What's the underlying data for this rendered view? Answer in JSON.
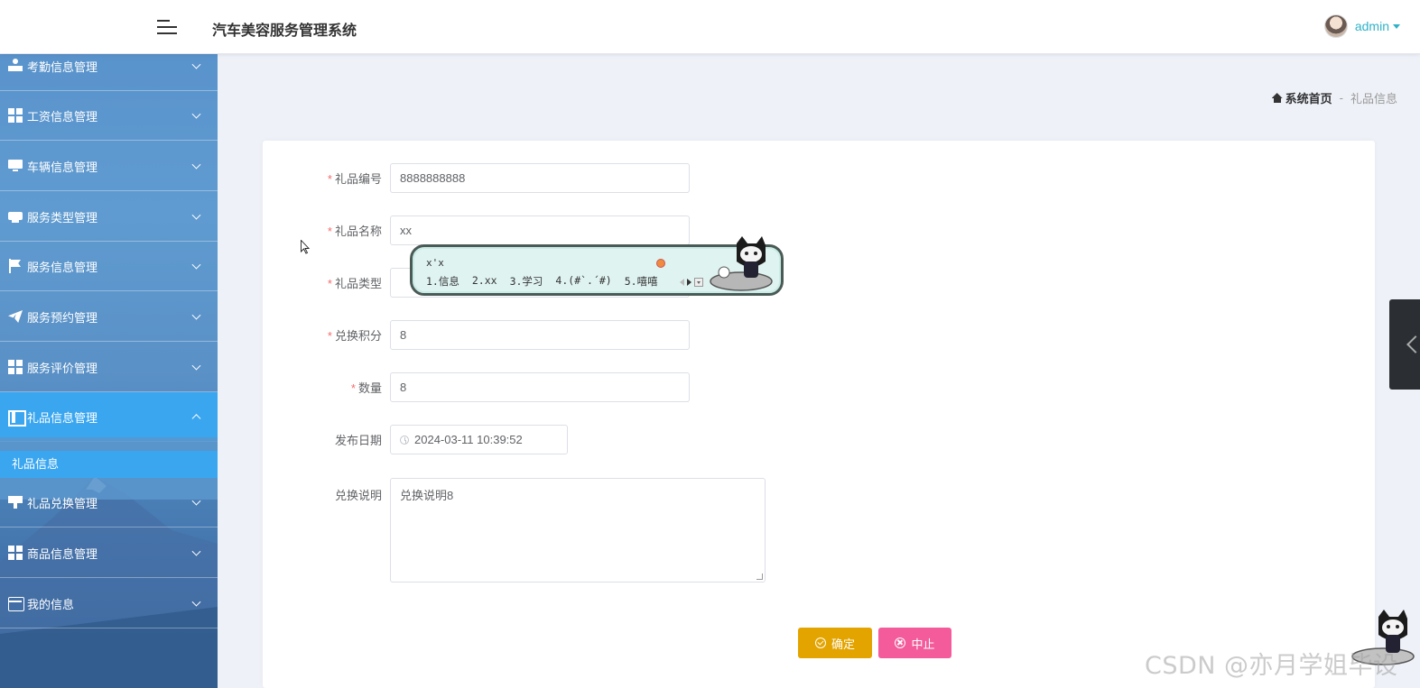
{
  "header": {
    "app_title": "汽车美容服务管理系统",
    "username": "admin"
  },
  "sidebar": {
    "items": [
      {
        "label": "考勤信息管理",
        "icon": "person-stamp-icon"
      },
      {
        "label": "工资信息管理",
        "icon": "grid-icon"
      },
      {
        "label": "车辆信息管理",
        "icon": "monitor-icon"
      },
      {
        "label": "服务类型管理",
        "icon": "printer-icon"
      },
      {
        "label": "服务信息管理",
        "icon": "flag-icon"
      },
      {
        "label": "服务预约管理",
        "icon": "paper-plane-icon"
      },
      {
        "label": "服务评价管理",
        "icon": "grid-icon"
      },
      {
        "label": "礼品信息管理",
        "icon": "book-icon",
        "active": true
      },
      {
        "label": "礼品兑换管理",
        "icon": "stamp-icon"
      },
      {
        "label": "商品信息管理",
        "icon": "grid-icon"
      },
      {
        "label": "我的信息",
        "icon": "wallet-icon"
      }
    ],
    "submenu_active": "礼品信息"
  },
  "breadcrumb": {
    "home": "系统首页",
    "separator": "-",
    "current": "礼品信息"
  },
  "form": {
    "gift_no": {
      "label": "礼品编号",
      "value": "8888888888"
    },
    "gift_name": {
      "label": "礼品名称",
      "value": "xx"
    },
    "gift_type": {
      "label": "礼品类型"
    },
    "points": {
      "label": "兑换积分",
      "value": "8"
    },
    "quantity": {
      "label": "数量",
      "value": "8"
    },
    "publish_date": {
      "label": "发布日期",
      "value": "2024-03-11 10:39:52"
    },
    "description": {
      "label": "兑换说明",
      "value": "兑换说明8"
    },
    "required_mark": "*",
    "confirm_label": "确定",
    "abort_label": "中止"
  },
  "ime": {
    "composition": "x'x",
    "candidates": [
      "1.信息",
      "2.xx",
      "3.学习",
      "4.(#`.´#)",
      "5.嘻嘻"
    ]
  },
  "watermark": "CSDN @亦月学姐毕设",
  "colors": {
    "accent": "#3aa6f0",
    "username": "#2fb2c8",
    "confirm_button": "#e4a400",
    "abort_button": "#f35b9a",
    "required": "#f56c6c"
  }
}
